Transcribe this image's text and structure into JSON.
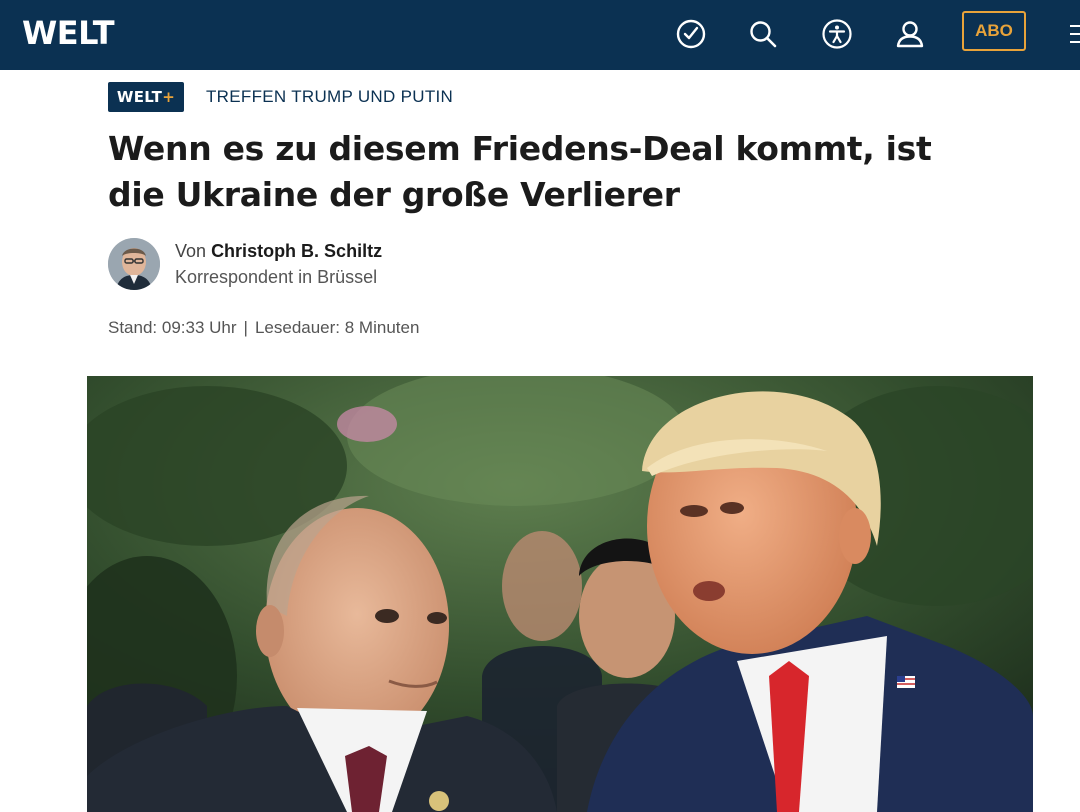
{
  "header": {
    "logo": "WELT",
    "icons": [
      "clock-check-icon",
      "search-icon",
      "accessibility-icon",
      "user-icon",
      "menu-icon"
    ],
    "abo_label": "ABO",
    "background_color": "#0b3152",
    "accent_color": "#e8a33a"
  },
  "kicker": {
    "badge_text": "WELT",
    "badge_plus": "+",
    "topic": "TREFFEN TRUMP UND PUTIN"
  },
  "article": {
    "headline": "Wenn es zu diesem Friedens-Deal kommt, ist die Ukraine der große Verlierer",
    "author_prefix": "Von",
    "author_name": "Christoph B. Schiltz",
    "author_role": "Korrespondent in Brüssel",
    "stand_label": "Stand: 09:33 Uhr",
    "separator": "|",
    "reading_time": "Lesedauer: 8 Minuten"
  },
  "hero_image": {
    "description_icon": "photo-image"
  }
}
